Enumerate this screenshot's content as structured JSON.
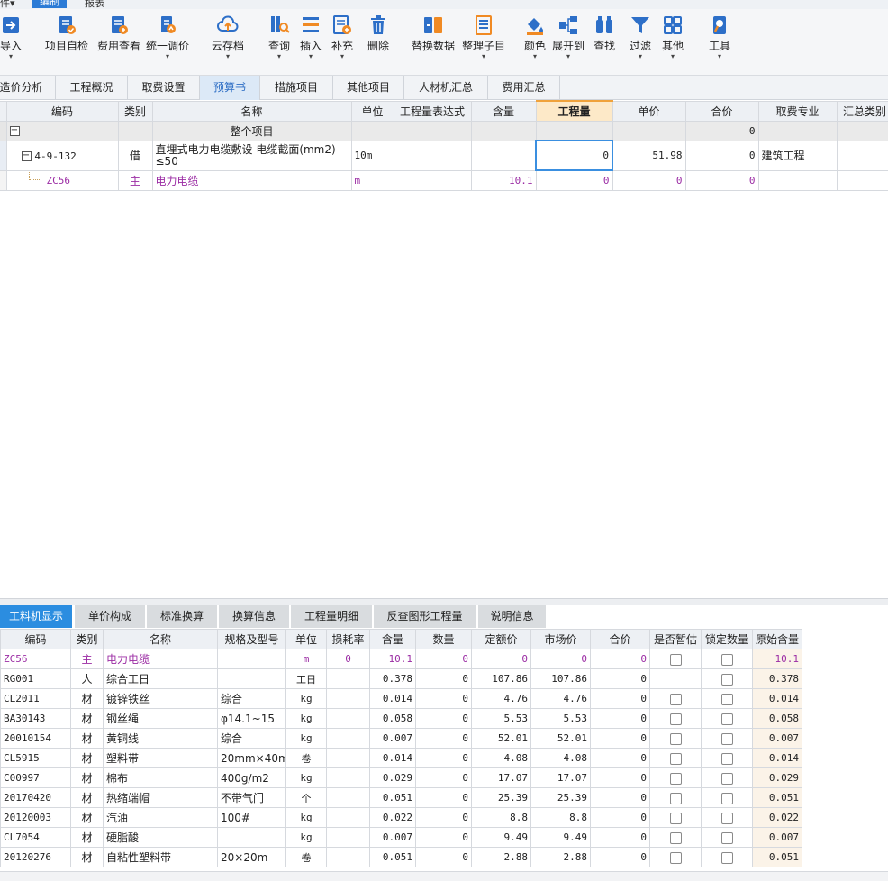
{
  "menubar": {
    "left": "件▾",
    "active": "编制",
    "right": "报表"
  },
  "ribbon": [
    {
      "label": "导入",
      "icon": "import-icon",
      "dropdown": true
    },
    {
      "label": "项目自检",
      "icon": "project-check-icon",
      "dropdown": false
    },
    {
      "label": "费用查看",
      "icon": "fee-view-icon",
      "dropdown": false
    },
    {
      "label": "统一调价",
      "icon": "unified-price-icon",
      "dropdown": true
    },
    {
      "label": "云存档",
      "icon": "cloud-upload-icon",
      "dropdown": true
    },
    {
      "label": "查询",
      "icon": "query-icon",
      "dropdown": true
    },
    {
      "label": "插入",
      "icon": "insert-icon",
      "dropdown": true
    },
    {
      "label": "补充",
      "icon": "supplement-icon",
      "dropdown": true
    },
    {
      "label": "删除",
      "icon": "trash-icon",
      "dropdown": false
    },
    {
      "label": "替换数据",
      "icon": "replace-data-icon",
      "dropdown": false
    },
    {
      "label": "整理子目",
      "icon": "organize-icon",
      "dropdown": true
    },
    {
      "label": "颜色",
      "icon": "paint-bucket-icon",
      "dropdown": true
    },
    {
      "label": "展开到",
      "icon": "expand-tree-icon",
      "dropdown": true
    },
    {
      "label": "查找",
      "icon": "binoculars-icon",
      "dropdown": false
    },
    {
      "label": "过滤",
      "icon": "filter-icon",
      "dropdown": true
    },
    {
      "label": "其他",
      "icon": "grid-apps-icon",
      "dropdown": true
    },
    {
      "label": "工具",
      "icon": "tools-icon",
      "dropdown": true
    }
  ],
  "tabs": [
    "造价分析",
    "工程概况",
    "取费设置",
    "预算书",
    "措施项目",
    "其他项目",
    "人材机汇总",
    "费用汇总"
  ],
  "selected_tab": "预算书",
  "main": {
    "headers": [
      "编码",
      "类别",
      "名称",
      "单位",
      "工程量表达式",
      "含量",
      "工程量",
      "单价",
      "合价",
      "取费专业",
      "汇总类别"
    ],
    "group_row": {
      "expander": "−",
      "name": "整个项目",
      "total": "0"
    },
    "rows": [
      {
        "expander": "−",
        "code": "4-9-132",
        "type": "借",
        "name1": "直埋式电力电缆敷设 电缆截面(mm2)",
        "name2": "≤50",
        "unit": "10m",
        "expr": "",
        "content": "",
        "qty": "0",
        "price": "51.98",
        "total": "0",
        "fee_major": "建筑工程",
        "sum_cat": ""
      },
      {
        "code": "ZC56",
        "type": "主",
        "name": "电力电缆",
        "unit": "m",
        "expr": "",
        "content": "10.1",
        "qty": "0",
        "price": "0",
        "total": "0",
        "fee_major": "",
        "sum_cat": ""
      }
    ]
  },
  "bottom_tabs": [
    "工料机显示",
    "单价构成",
    "标准换算",
    "换算信息",
    "工程量明细",
    "反查图形工程量",
    "说明信息"
  ],
  "bottom_selected": "工料机显示",
  "materials": {
    "headers": [
      "编码",
      "类别",
      "名称",
      "规格及型号",
      "单位",
      "损耗率",
      "含量",
      "数量",
      "定额价",
      "市场价",
      "合价",
      "是否暂估",
      "锁定数量",
      "原始含量"
    ],
    "rows": [
      {
        "code": "ZC56",
        "type": "主",
        "name": "电力电缆",
        "spec": "",
        "unit": "m",
        "loss": "0",
        "content": "10.1",
        "qty": "0",
        "base": "0",
        "market": "0",
        "total": "0",
        "est": true,
        "lock": true,
        "orig": "10.1",
        "purple": true
      },
      {
        "code": "RG001",
        "type": "人",
        "name": "综合工日",
        "spec": "",
        "unit": "工日",
        "loss": "",
        "content": "0.378",
        "qty": "0",
        "base": "107.86",
        "market": "107.86",
        "total": "0",
        "est": false,
        "lock": true,
        "orig": "0.378"
      },
      {
        "code": "CL2011",
        "type": "材",
        "name": "镀锌铁丝",
        "spec": "综合",
        "unit": "kg",
        "loss": "",
        "content": "0.014",
        "qty": "0",
        "base": "4.76",
        "market": "4.76",
        "total": "0",
        "est": true,
        "lock": true,
        "orig": "0.014"
      },
      {
        "code": "BA30143",
        "type": "材",
        "name": "钢丝绳",
        "spec": "φ14.1~15",
        "unit": "kg",
        "loss": "",
        "content": "0.058",
        "qty": "0",
        "base": "5.53",
        "market": "5.53",
        "total": "0",
        "est": true,
        "lock": true,
        "orig": "0.058"
      },
      {
        "code": "20010154",
        "type": "材",
        "name": "黄铜线",
        "spec": "综合",
        "unit": "kg",
        "loss": "",
        "content": "0.007",
        "qty": "0",
        "base": "52.01",
        "market": "52.01",
        "total": "0",
        "est": true,
        "lock": true,
        "orig": "0.007"
      },
      {
        "code": "CL5915",
        "type": "材",
        "name": "塑料带",
        "spec": "20mm×40m",
        "unit": "卷",
        "loss": "",
        "content": "0.014",
        "qty": "0",
        "base": "4.08",
        "market": "4.08",
        "total": "0",
        "est": true,
        "lock": true,
        "orig": "0.014"
      },
      {
        "code": "C00997",
        "type": "材",
        "name": "棉布",
        "spec": "400g/m2",
        "unit": "kg",
        "loss": "",
        "content": "0.029",
        "qty": "0",
        "base": "17.07",
        "market": "17.07",
        "total": "0",
        "est": true,
        "lock": true,
        "orig": "0.029"
      },
      {
        "code": "20170420",
        "type": "材",
        "name": "热缩端帽",
        "spec": "不带气门",
        "unit": "个",
        "loss": "",
        "content": "0.051",
        "qty": "0",
        "base": "25.39",
        "market": "25.39",
        "total": "0",
        "est": true,
        "lock": true,
        "orig": "0.051"
      },
      {
        "code": "20120003",
        "type": "材",
        "name": "汽油",
        "spec": "100#",
        "unit": "kg",
        "loss": "",
        "content": "0.022",
        "qty": "0",
        "base": "8.8",
        "market": "8.8",
        "total": "0",
        "est": true,
        "lock": true,
        "orig": "0.022"
      },
      {
        "code": "CL7054",
        "type": "材",
        "name": "硬脂酸",
        "spec": "",
        "unit": "kg",
        "loss": "",
        "content": "0.007",
        "qty": "0",
        "base": "9.49",
        "market": "9.49",
        "total": "0",
        "est": true,
        "lock": true,
        "orig": "0.007"
      },
      {
        "code": "20120276",
        "type": "材",
        "name": "自粘性塑料带",
        "spec": "20×20m",
        "unit": "卷",
        "loss": "",
        "content": "0.051",
        "qty": "0",
        "base": "2.88",
        "market": "2.88",
        "total": "0",
        "est": true,
        "lock": true,
        "orig": "0.051"
      }
    ]
  },
  "colors": {
    "accent": "#2b8de0",
    "ribbon_orange": "#f08a24",
    "ribbon_blue": "#2d6fc8",
    "main_material": "#9b2ca4"
  }
}
